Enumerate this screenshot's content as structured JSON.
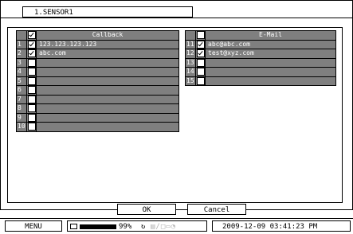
{
  "window": {
    "tab_title": "1.SENSOR1"
  },
  "callback": {
    "header": "Callback",
    "rows": [
      {
        "num": "1",
        "checked": true,
        "value": "123.123.123.123"
      },
      {
        "num": "2",
        "checked": true,
        "value": "abc.com"
      },
      {
        "num": "3",
        "checked": false,
        "value": ""
      },
      {
        "num": "4",
        "checked": false,
        "value": ""
      },
      {
        "num": "5",
        "checked": false,
        "value": ""
      },
      {
        "num": "6",
        "checked": false,
        "value": ""
      },
      {
        "num": "7",
        "checked": false,
        "value": ""
      },
      {
        "num": "8",
        "checked": false,
        "value": ""
      },
      {
        "num": "9",
        "checked": false,
        "value": ""
      },
      {
        "num": "10",
        "checked": false,
        "value": ""
      }
    ]
  },
  "email": {
    "header": "E-Mail",
    "rows": [
      {
        "num": "11",
        "checked": true,
        "value": "abc@abc.com"
      },
      {
        "num": "12",
        "checked": true,
        "value": "test@xyz.com"
      },
      {
        "num": "13",
        "checked": false,
        "value": ""
      },
      {
        "num": "14",
        "checked": false,
        "value": ""
      },
      {
        "num": "15",
        "checked": false,
        "value": ""
      }
    ]
  },
  "buttons": {
    "ok": "OK",
    "cancel": "Cancel"
  },
  "statusbar": {
    "menu": "MENU",
    "disk_percent": "99%",
    "datetime": "2009-12-09 03:41:23 PM"
  }
}
